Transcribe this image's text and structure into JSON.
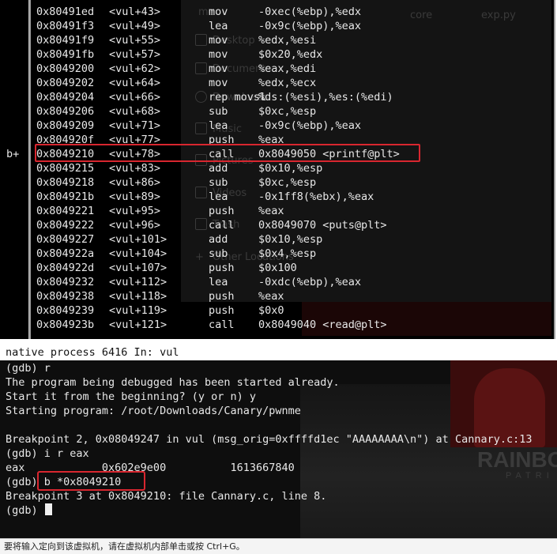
{
  "disassembly": {
    "breakpoint_marker": "b+",
    "lines": [
      {
        "addr": "0x80491ed",
        "sym": "<vul+43>",
        "mnemonic": "mov",
        "operands": "-0xec(%ebp),%edx"
      },
      {
        "addr": "0x80491f3",
        "sym": "<vul+49>",
        "mnemonic": "lea",
        "operands": "-0x9c(%ebp),%eax"
      },
      {
        "addr": "0x80491f9",
        "sym": "<vul+55>",
        "mnemonic": "mov",
        "operands": "%edx,%esi"
      },
      {
        "addr": "0x80491fb",
        "sym": "<vul+57>",
        "mnemonic": "mov",
        "operands": "$0x20,%edx"
      },
      {
        "addr": "0x8049200",
        "sym": "<vul+62>",
        "mnemonic": "mov",
        "operands": "%eax,%edi"
      },
      {
        "addr": "0x8049202",
        "sym": "<vul+64>",
        "mnemonic": "mov",
        "operands": "%edx,%ecx"
      },
      {
        "addr": "0x8049204",
        "sym": "<vul+66>",
        "mnemonic": "rep movsl",
        "operands": "%ds:(%esi),%es:(%edi)"
      },
      {
        "addr": "0x8049206",
        "sym": "<vul+68>",
        "mnemonic": "sub",
        "operands": "$0xc,%esp"
      },
      {
        "addr": "0x8049209",
        "sym": "<vul+71>",
        "mnemonic": "lea",
        "operands": "-0x9c(%ebp),%eax"
      },
      {
        "addr": "0x804920f",
        "sym": "<vul+77>",
        "mnemonic": "push",
        "operands": "%eax"
      },
      {
        "addr": "0x8049210",
        "sym": "<vul+78>",
        "mnemonic": "call",
        "operands": "0x8049050 <printf@plt>"
      },
      {
        "addr": "0x8049215",
        "sym": "<vul+83>",
        "mnemonic": "add",
        "operands": "$0x10,%esp"
      },
      {
        "addr": "0x8049218",
        "sym": "<vul+86>",
        "mnemonic": "sub",
        "operands": "$0xc,%esp"
      },
      {
        "addr": "0x804921b",
        "sym": "<vul+89>",
        "mnemonic": "lea",
        "operands": "-0x1ff8(%ebx),%eax"
      },
      {
        "addr": "0x8049221",
        "sym": "<vul+95>",
        "mnemonic": "push",
        "operands": "%eax"
      },
      {
        "addr": "0x8049222",
        "sym": "<vul+96>",
        "mnemonic": "call",
        "operands": "0x8049070 <puts@plt>"
      },
      {
        "addr": "0x8049227",
        "sym": "<vul+101>",
        "mnemonic": "add",
        "operands": "$0x10,%esp"
      },
      {
        "addr": "0x804922a",
        "sym": "<vul+104>",
        "mnemonic": "sub",
        "operands": "$0x4,%esp"
      },
      {
        "addr": "0x804922d",
        "sym": "<vul+107>",
        "mnemonic": "push",
        "operands": "$0x100"
      },
      {
        "addr": "0x8049232",
        "sym": "<vul+112>",
        "mnemonic": "lea",
        "operands": "-0xdc(%ebp),%eax"
      },
      {
        "addr": "0x8049238",
        "sym": "<vul+118>",
        "mnemonic": "push",
        "operands": "%eax"
      },
      {
        "addr": "0x8049239",
        "sym": "<vul+119>",
        "mnemonic": "push",
        "operands": "$0x0"
      },
      {
        "addr": "0x804923b",
        "sym": "<vul+121>",
        "mnemonic": "call",
        "operands": "0x8049040 <read@plt>"
      }
    ]
  },
  "background_window": {
    "sidebar_items": [
      "me",
      "Desktop",
      "Documents",
      "Downloads",
      "Music",
      "Pictures",
      "Videos",
      "Trash",
      "Other Locations"
    ],
    "top_items": [
      "core",
      "exp.py"
    ]
  },
  "status": {
    "text": "native process 6416 In: vul"
  },
  "console": {
    "lines": [
      "(gdb) r",
      "The program being debugged has been started already.",
      "Start it from the beginning? (y or n) y",
      "Starting program: /root/Downloads/Canary/pwnme",
      "",
      "Breakpoint 2, 0x08049247 in vul (msg_orig=0xffffd1ec \"AAAAAAAA\\n\") at Cannary.c:13",
      "(gdb) i r eax",
      "eax            0x602e9e00          1613667840",
      "(gdb) b *0x8049210",
      "Breakpoint 3 at 0x8049210: file Cannary.c, line 8."
    ],
    "prompt": "(gdb) "
  },
  "background_art": {
    "logo_text": "RAINBO",
    "logo_sub": "PATRI"
  },
  "footer": {
    "hint": "要将输入定向到该虚拟机，请在虚拟机内部单击或按 Ctrl+G。"
  },
  "colors": {
    "highlight_box": "#d8262f",
    "terminal_bg": "#000000",
    "terminal_fg": "#e8e8e8"
  }
}
